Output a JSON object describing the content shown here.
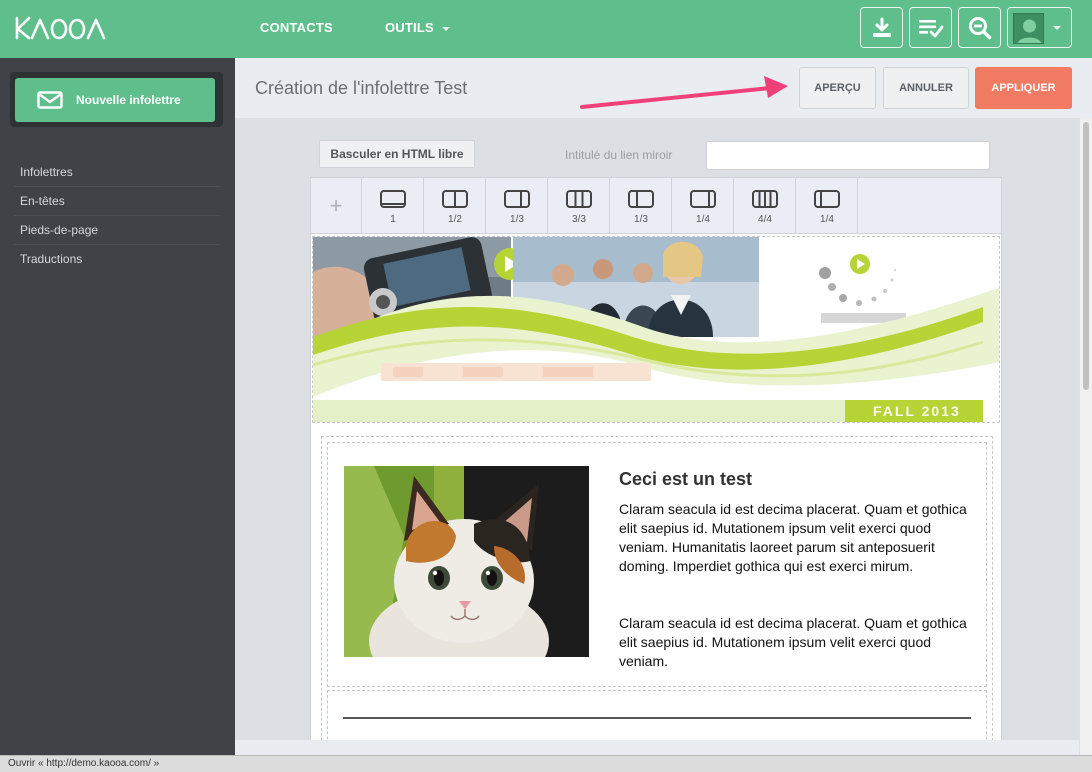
{
  "app": {
    "logo": "KAOOA",
    "brand_color": "#5fbf8c",
    "accent_color": "#f07a62"
  },
  "nav": [
    {
      "label": "CONTACTS",
      "has_dropdown": false
    },
    {
      "label": "OUTILS",
      "has_dropdown": true
    }
  ],
  "toolbar_icons": [
    "download-icon",
    "checklist-icon",
    "zoom-out-icon"
  ],
  "sidebar": {
    "new_button": "Nouvelle infolettre",
    "items": [
      {
        "label": "Infolettres"
      },
      {
        "label": "En-têtes"
      },
      {
        "label": "Pieds-de-page"
      },
      {
        "label": "Traductions"
      }
    ]
  },
  "header": {
    "title": "Création de l'infolettre Test",
    "preview_label": "APERÇU",
    "cancel_label": "ANNULER",
    "apply_label": "APPLIQUER"
  },
  "editor": {
    "html_toggle": "Basculer en HTML libre",
    "mirror_label": "Intitulé du lien miroir",
    "mirror_value": "",
    "layouts": [
      {
        "label": "1"
      },
      {
        "label": "1/2"
      },
      {
        "label": "1/3"
      },
      {
        "label": "3/3"
      },
      {
        "label": "1/3"
      },
      {
        "label": "1/4"
      },
      {
        "label": "4/4"
      },
      {
        "label": "1/4"
      }
    ],
    "add_label": "+",
    "banner_text": "FALL 2013",
    "article": {
      "title": "Ceci est un test",
      "paragraph1": "Claram seacula id est decima placerat. Quam et gothica elit saepius id. Mutationem ipsum velit exerci quod veniam. Humanitatis laoreet parum sit anteposuerit doming. Imperdiet gothica qui est exerci mirum.",
      "paragraph2": "Claram seacula id est decima placerat. Quam et gothica elit saepius id. Mutationem ipsum velit exerci quod veniam."
    }
  },
  "statusbar": {
    "text": "Ouvrir « http://demo.kaooa.com/ »"
  }
}
